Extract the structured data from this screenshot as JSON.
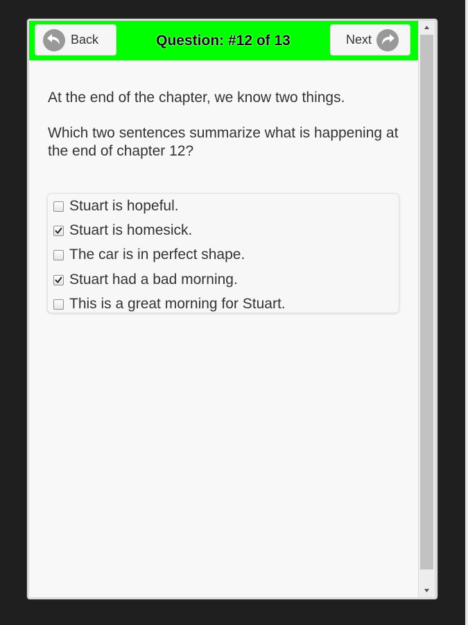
{
  "header": {
    "back_label": "Back",
    "title": "Question: #12 of 13",
    "next_label": "Next",
    "accent_color": "#00ff00"
  },
  "question": {
    "intro": "At the end of the chapter, we know two things.",
    "prompt": "Which two sentences summarize what is happening at the end of chapter 12?"
  },
  "options": [
    {
      "label": "Stuart is hopeful.",
      "checked": false
    },
    {
      "label": "Stuart is homesick.",
      "checked": true
    },
    {
      "label": "The car is in perfect shape.",
      "checked": false
    },
    {
      "label": "Stuart had a bad morning.",
      "checked": true
    },
    {
      "label": "This is a great morning for Stuart.",
      "checked": false
    }
  ],
  "icons": {
    "back": "undo-arrow-icon",
    "next": "redo-arrow-icon",
    "checkmark": "checkmark-icon",
    "scroll_up": "triangle-up-icon",
    "scroll_down": "triangle-down-icon"
  }
}
